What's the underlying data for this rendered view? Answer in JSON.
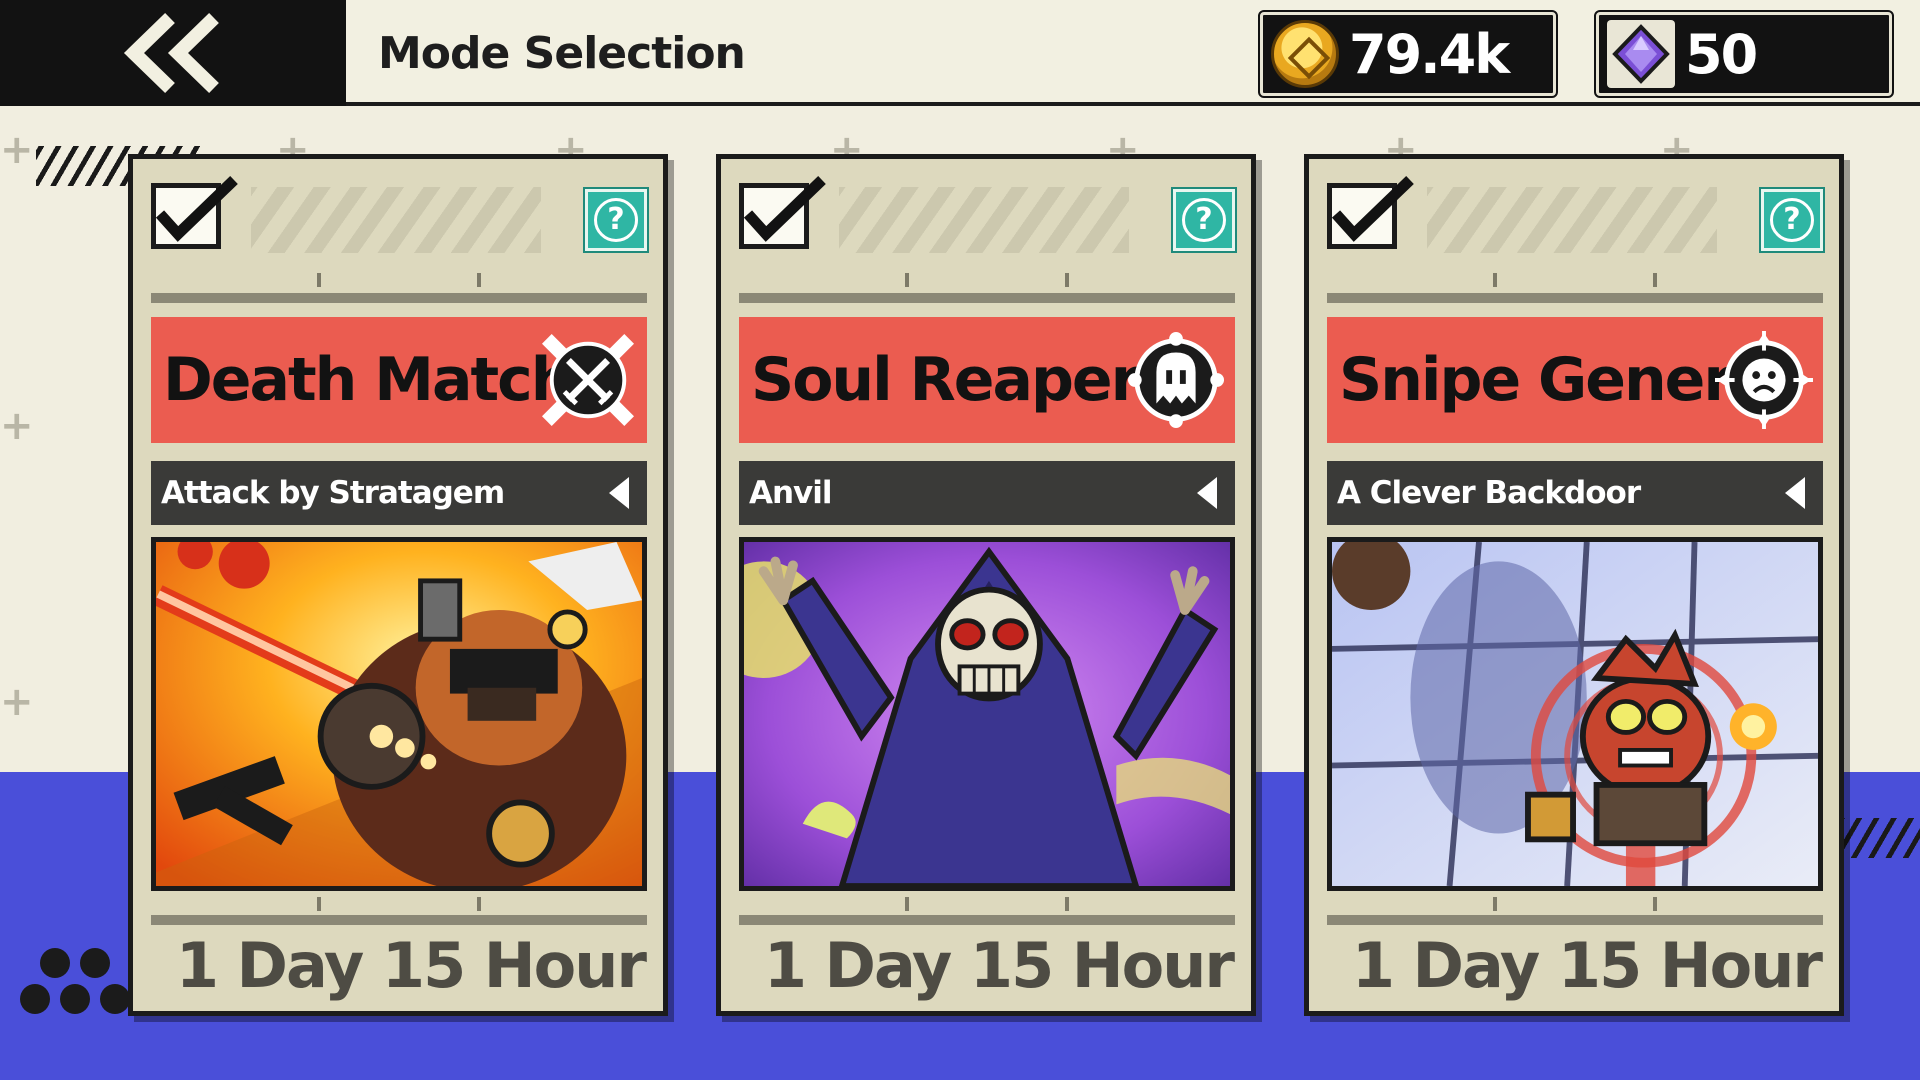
{
  "header": {
    "back_icon": "double-chevron-left-icon",
    "title": "Mode Selection",
    "gold": {
      "icon": "gold-coin-icon",
      "value": "79.4k"
    },
    "gems": {
      "icon": "purple-gem-icon",
      "value": "50"
    }
  },
  "cards": [
    {
      "mode_name": "Death Match",
      "mode_icon": "crossed-swords-icon",
      "map_name": "Attack by Stratagem",
      "timer": "1 Day 15 Hour",
      "help_label": "?",
      "art": "armored-warrior-with-flaming-sword"
    },
    {
      "mode_name": "Soul Reaper",
      "mode_icon": "ghost-icon",
      "map_name": "Anvil",
      "timer": "1 Day 15 Hour",
      "help_label": "?",
      "art": "hooded-skull-reaper-with-ghosts"
    },
    {
      "mode_name": "Snipe General",
      "mode_icon": "crosshair-face-icon",
      "map_name": "A Clever Backdoor",
      "timer": "1 Day 15 Hour",
      "help_label": "?",
      "art": "red-bearded-general-in-crosshair"
    }
  ],
  "colors": {
    "background": "#f1eee0",
    "bottom_band": "#4a4fd9",
    "card": "#ddd9be",
    "mode_banner": "#eb5c50",
    "map_bar": "#3a3a38",
    "help_button": "#2fb6a4"
  }
}
